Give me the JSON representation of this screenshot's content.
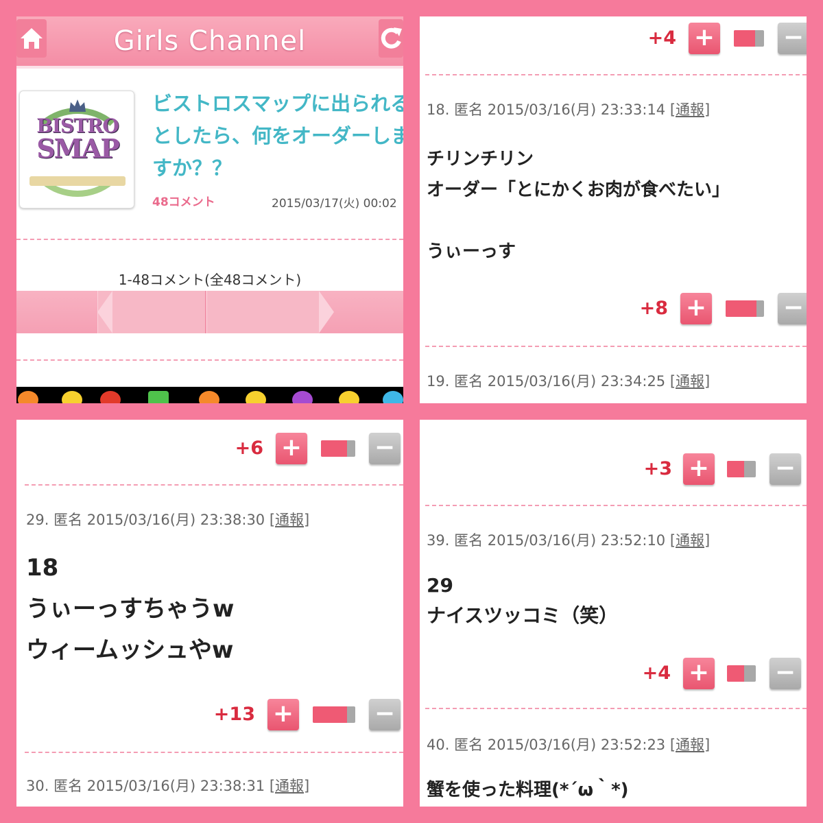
{
  "header": {
    "title": "Girls Channel",
    "home_icon": "home-icon",
    "refresh_icon": "refresh-icon"
  },
  "article": {
    "thumbnail_line1": "BISTRO",
    "thumbnail_line2": "SMAP",
    "title": "ビストロスマップに出られるとしたら、何をオーダーしますか？？",
    "comment_count": "48コメント",
    "date": "2015/03/17(火) 00:02",
    "range": "1-48コメント(全48コメント)"
  },
  "comments": {
    "c18": {
      "meta": "18. 匿名 2015/03/16(月) 23:33:14",
      "report": "[通報]",
      "lines": [
        "チリンチリン",
        "オーダー「とにかくお肉が食べたい」",
        "",
        "うぃーっす"
      ],
      "score": "+8",
      "ratio": 0.8
    },
    "c19": {
      "meta": "19. 匿名 2015/03/16(月) 23:34:25",
      "report": "[通報]"
    },
    "c29": {
      "meta": "29. 匿名 2015/03/16(月) 23:38:30",
      "report": "[通報]",
      "lines": [
        "18",
        "うぃーっすちゃうw",
        "ウィームッシュやw"
      ],
      "score": "+13",
      "ratio": 0.8
    },
    "c30": {
      "meta": "30. 匿名 2015/03/16(月) 23:38:31",
      "report": "[通報]"
    },
    "c39": {
      "meta": "39. 匿名 2015/03/16(月) 23:52:10",
      "report": "[通報]",
      "lines": [
        "29",
        "ナイスツッコミ（笑）"
      ],
      "score": "+4",
      "ratio": 0.6
    },
    "c40": {
      "meta": "40. 匿名 2015/03/16(月) 23:52:23",
      "report": "[通報]",
      "lines": [
        "蟹を使った料理(*´ω｀*)"
      ]
    }
  },
  "prev_votes": {
    "p2_top": {
      "score": "+4",
      "ratio": 0.7
    },
    "p3_top": {
      "score": "+6",
      "ratio": 0.75
    },
    "p4_top": {
      "score": "+3",
      "ratio": 0.6
    }
  },
  "vote_labels": {
    "plus": "+",
    "minus": "−"
  },
  "colors": {
    "background": "#f67a9b",
    "accent": "#43b7c6",
    "score": "#d92b3f",
    "plus": "#e95570",
    "minus": "#a9a9a9"
  }
}
